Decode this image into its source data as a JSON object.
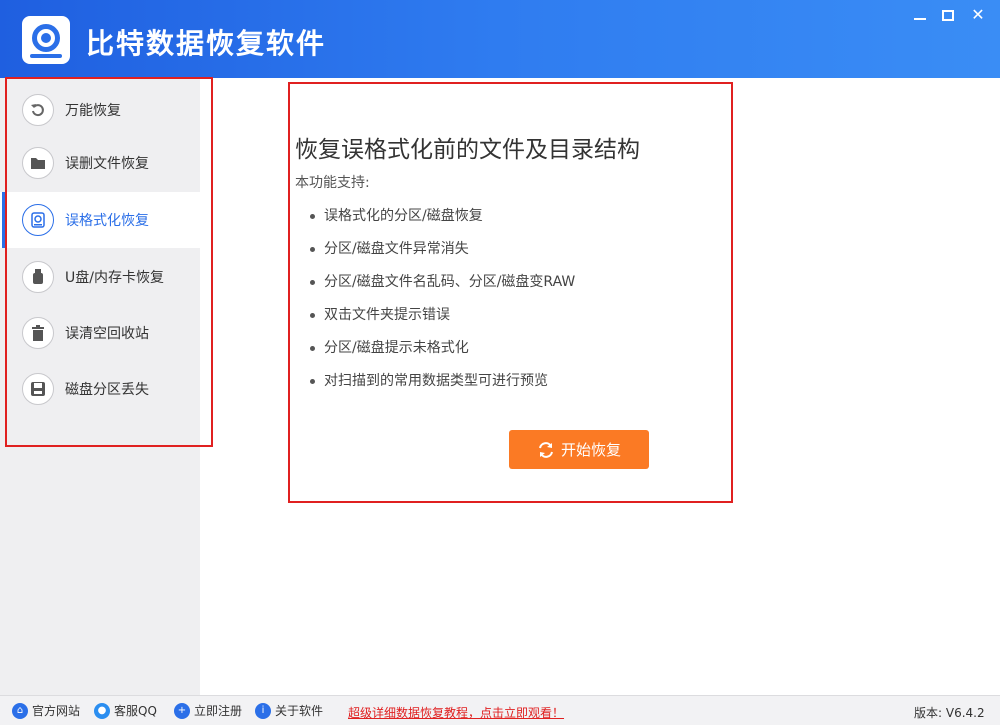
{
  "app": {
    "title": "比特数据恢复软件",
    "window_controls": {
      "minimize": "–",
      "maximize": "□",
      "close": "✕"
    }
  },
  "sidebar": {
    "items": [
      {
        "label": "万能恢复",
        "icon": "undo-icon",
        "active": false
      },
      {
        "label": "误删文件恢复",
        "icon": "folder-icon",
        "active": false
      },
      {
        "label": "误格式化恢复",
        "icon": "format-disk-icon",
        "active": true
      },
      {
        "label": "U盘/内存卡恢复",
        "icon": "usb-drive-icon",
        "active": false
      },
      {
        "label": "误清空回收站",
        "icon": "trash-icon",
        "active": false
      },
      {
        "label": "磁盘分区丢失",
        "icon": "disk-icon",
        "active": false
      }
    ]
  },
  "main": {
    "title": "恢复误格式化前的文件及目录结构",
    "subtitle": "本功能支持:",
    "features": [
      "误格式化的分区/磁盘恢复",
      "分区/磁盘文件异常消失",
      "分区/磁盘文件名乱码、分区/磁盘变RAW",
      "双击文件夹提示错误",
      "分区/磁盘提示未格式化",
      "对扫描到的常用数据类型可进行预览"
    ],
    "start_button": "开始恢复"
  },
  "footer": {
    "links": [
      {
        "label": "官方网站",
        "icon": "home-icon"
      },
      {
        "label": "客服QQ",
        "icon": "qq-icon"
      },
      {
        "label": "立即注册",
        "icon": "user-register-icon"
      },
      {
        "label": "关于软件",
        "icon": "info-icon"
      }
    ],
    "promo": "超级详细数据恢复教程，点击立即观看！",
    "version": "版本: V6.4.2"
  },
  "colors": {
    "accent": "#2b6fe8",
    "start_button": "#fb7a24",
    "highlight_border": "#e02020",
    "promo_link": "#e02020"
  }
}
